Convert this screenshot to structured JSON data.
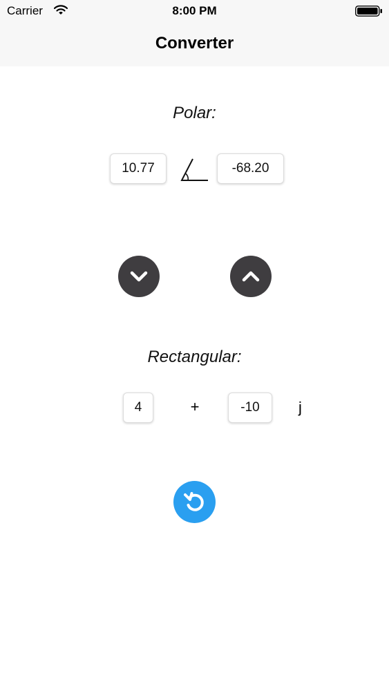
{
  "status_bar": {
    "carrier": "Carrier",
    "time": "8:00 PM",
    "icons": [
      "wifi-icon",
      "battery-icon"
    ]
  },
  "nav": {
    "title": "Converter"
  },
  "polar": {
    "heading": "Polar:",
    "magnitude": "10.77",
    "angle": "-68.20",
    "angle_symbol": "angle-icon"
  },
  "buttons": {
    "to_rectangular_icon": "chevron-down-icon",
    "to_polar_icon": "chevron-up-icon",
    "reset_icon": "reset-icon"
  },
  "rectangular": {
    "heading": "Rectangular:",
    "real": "4",
    "operator": "+",
    "imaginary": "-10",
    "imaginary_unit": "j"
  },
  "colors": {
    "bar_background": "#f7f7f7",
    "arrow_button": "#3f3d40",
    "reset_button": "#2a9ff0"
  }
}
